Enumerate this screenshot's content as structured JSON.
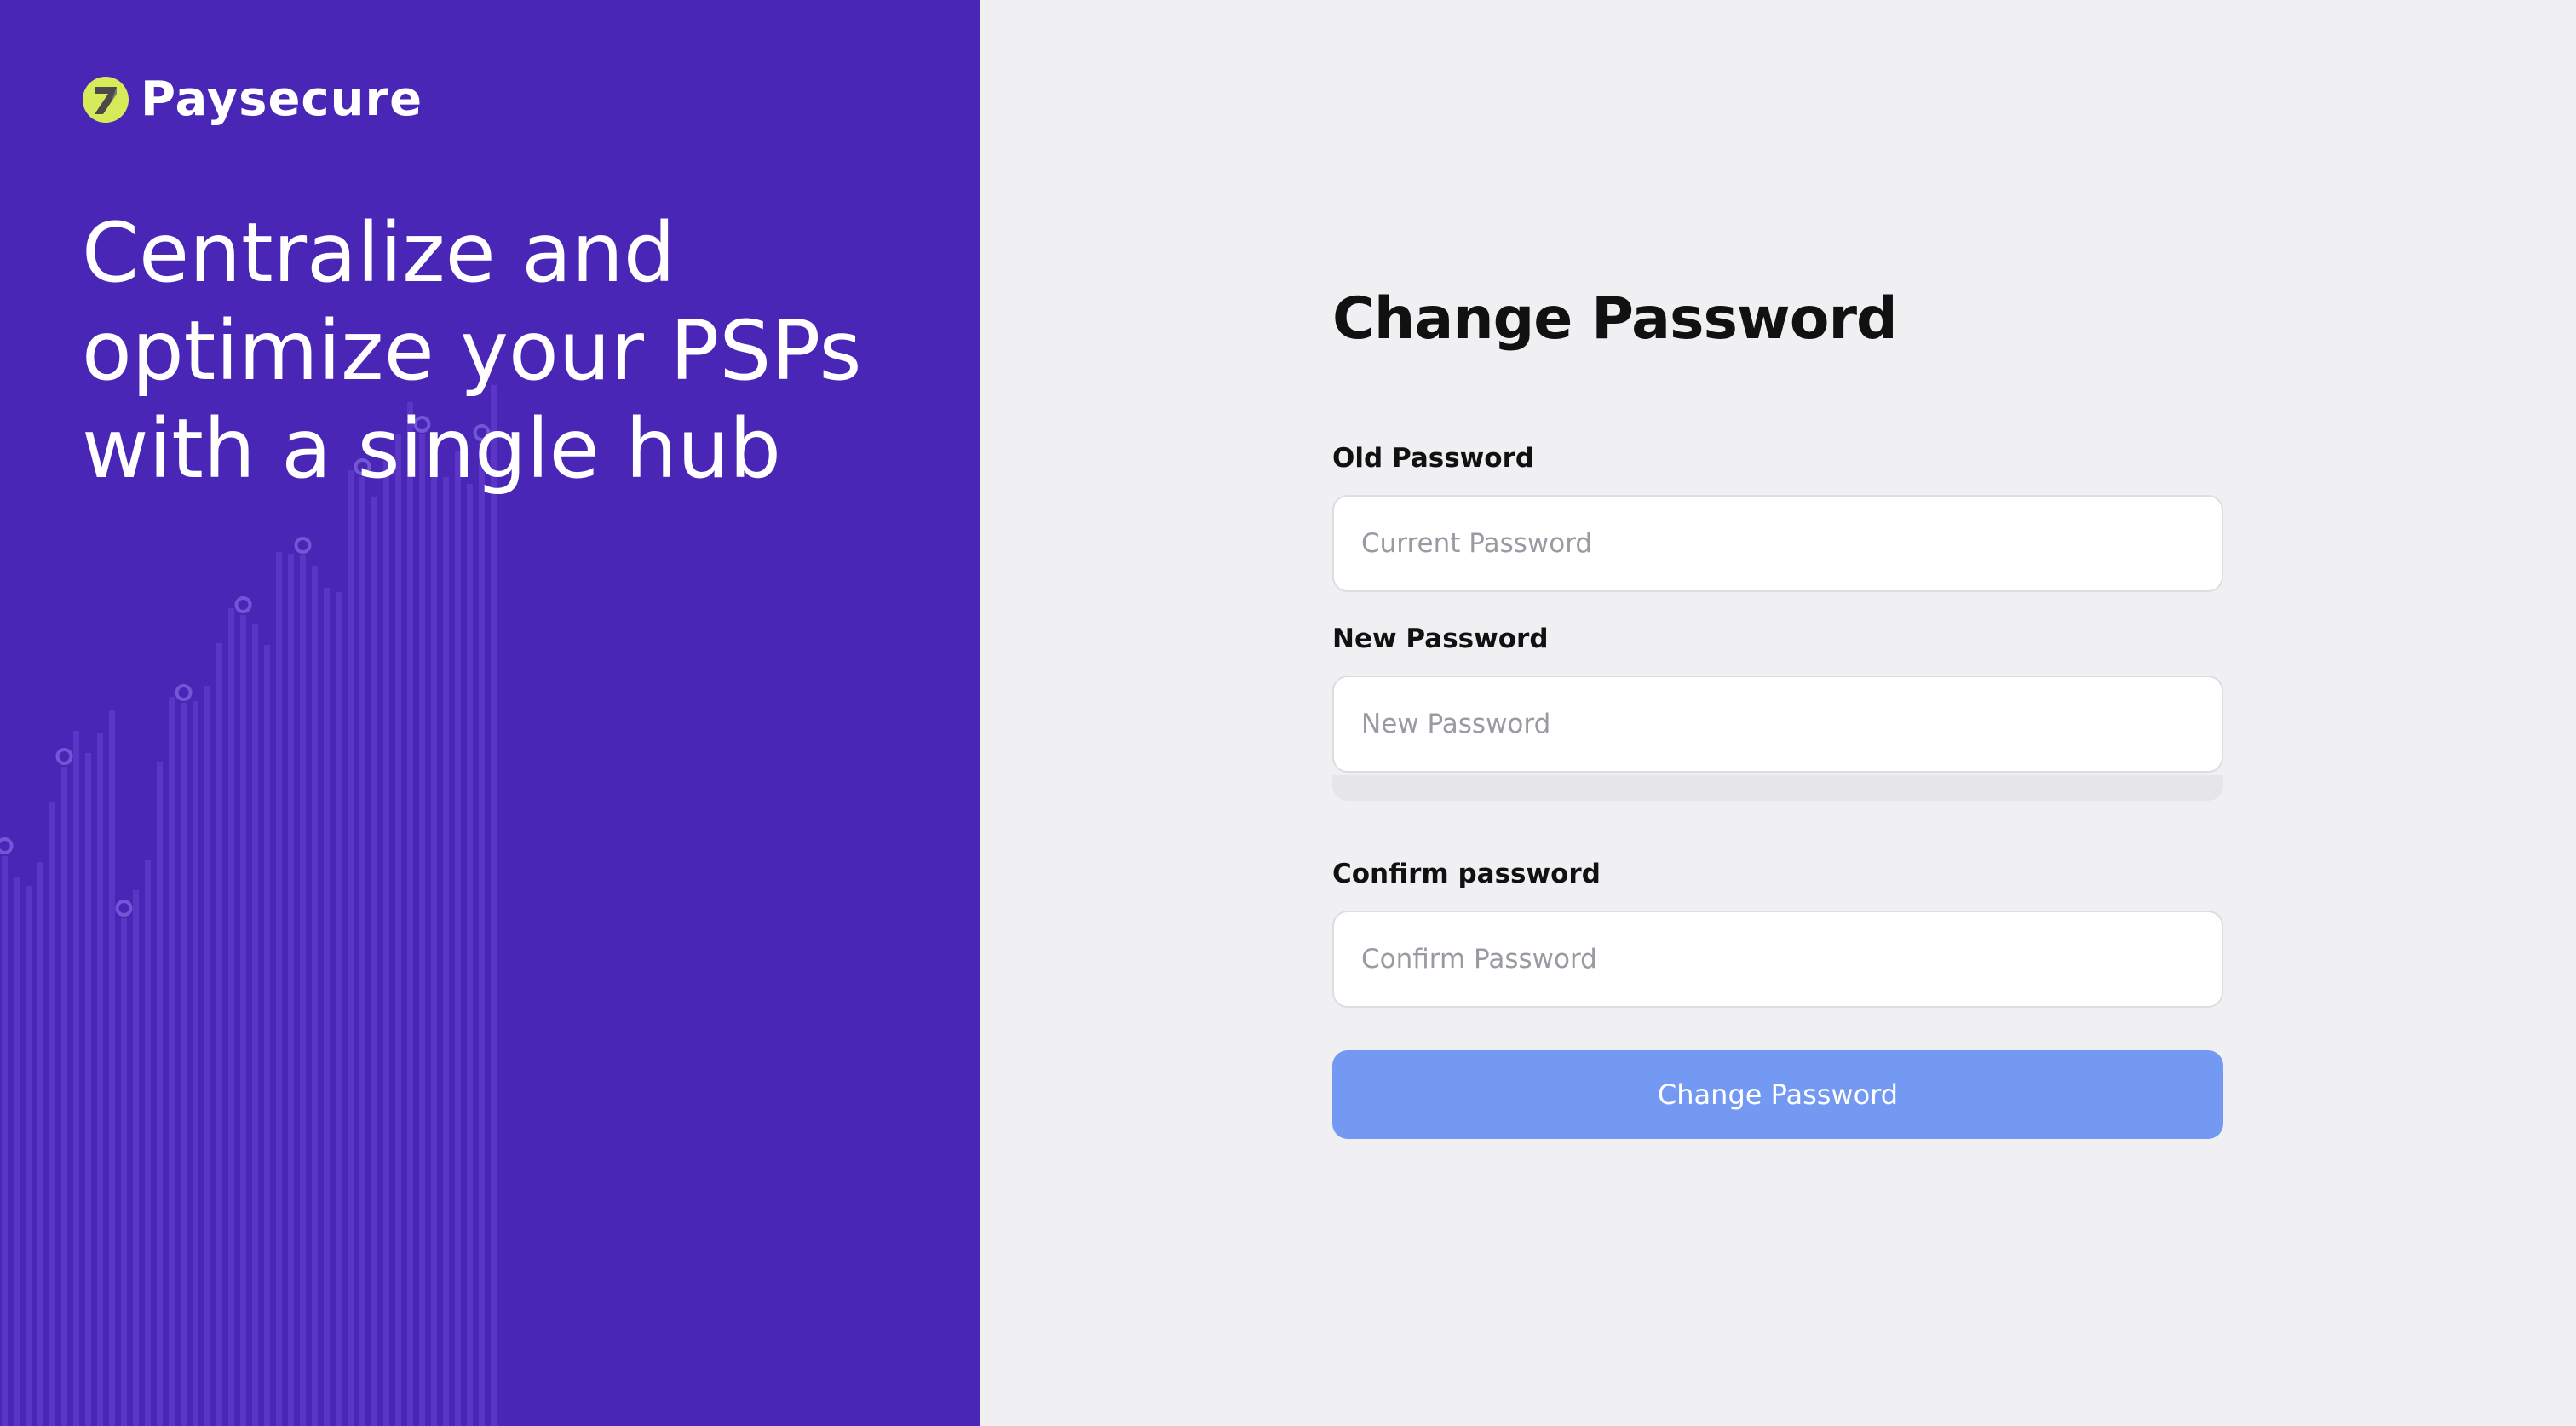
{
  "brand": {
    "name": "Paysecure",
    "logo_icon": "paysecure-logo-icon",
    "logo_color": "#d6ea5a",
    "panel_color": "#4a26b6"
  },
  "hero": {
    "headline_lines": [
      "Centralize and",
      "optimize your PSPs",
      "with a single hub"
    ]
  },
  "form": {
    "title": "Change Password",
    "old_password": {
      "label": "Old Password",
      "placeholder": "Current Password",
      "value": ""
    },
    "new_password": {
      "label": "New Password",
      "placeholder": "New Password",
      "value": ""
    },
    "confirm_password": {
      "label": "Confirm password",
      "placeholder": "Confirm Password",
      "value": ""
    },
    "submit_label": "Change Password",
    "submit_color": "#7399f2"
  }
}
